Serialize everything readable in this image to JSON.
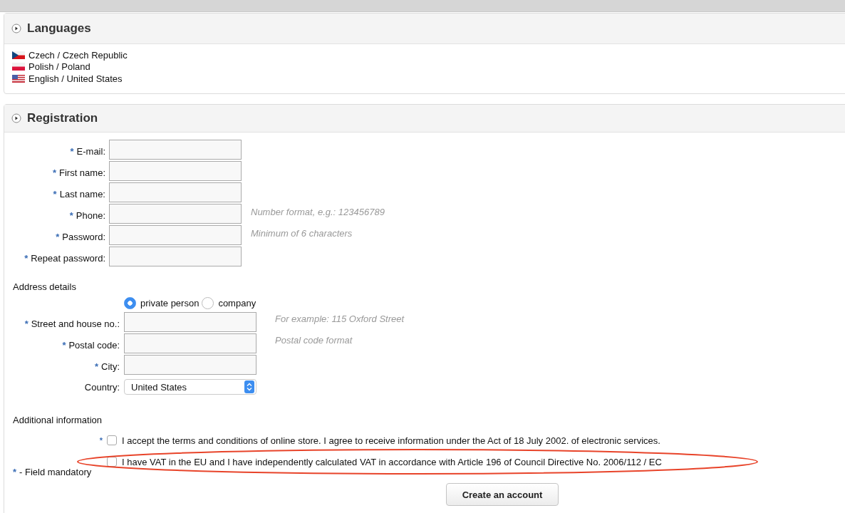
{
  "languages": {
    "title": "Languages",
    "items": [
      {
        "label": "Czech / Czech Republic",
        "kind": "czech"
      },
      {
        "label": "Polish / Poland",
        "kind": "polish"
      },
      {
        "label": "English / United States",
        "kind": "american"
      }
    ]
  },
  "registration": {
    "title": "Registration",
    "required_mark": "*",
    "account_fields": [
      {
        "label": "E-mail:",
        "required": true
      },
      {
        "label": "First name:",
        "required": true
      },
      {
        "label": "Last name:",
        "required": true
      },
      {
        "label": "Phone:",
        "required": true,
        "hint": "Number format, e.g.: 123456789"
      },
      {
        "label": "Password:",
        "required": true,
        "hint": "Minimum of 6 characters"
      },
      {
        "label": "Repeat password:",
        "required": true
      }
    ],
    "address": {
      "title": "Address details",
      "customer_type": [
        {
          "label": "private person",
          "selected": true
        },
        {
          "label": "company",
          "selected": false
        }
      ],
      "fields": [
        {
          "label": "Street and house no.:",
          "required": true,
          "hint": "For example: 115 Oxford Street"
        },
        {
          "label": "Postal code:",
          "required": true,
          "hint": "Postal code format"
        },
        {
          "label": "City:",
          "required": true
        }
      ],
      "country": {
        "label": "Country:",
        "value": "United States"
      }
    },
    "additional": {
      "title": "Additional information",
      "consents": [
        {
          "label": "I accept the terms and conditions of online store. I agree to receive information under the Act of 18 July 2002. of electronic services.",
          "required": true,
          "checked": false,
          "highlighted": false
        },
        {
          "label": "I have VAT in the EU and I have independently calculated VAT in accordance with Article 196 of Council Directive No. 2006/112 / EC",
          "required": false,
          "checked": false,
          "highlighted": true
        }
      ]
    },
    "mandatory_note": "- Field mandatory",
    "submit": "Create an account"
  }
}
